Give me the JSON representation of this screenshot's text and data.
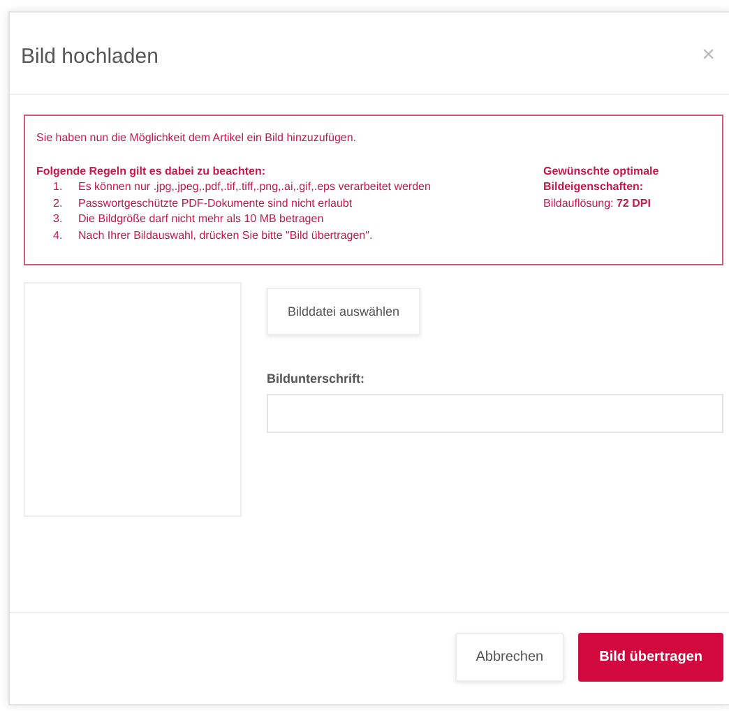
{
  "dialog": {
    "title": "Bild hochladen",
    "close": "×"
  },
  "notice": {
    "intro": "Sie haben nun die Möglichkeit dem Artikel ein Bild hinzuzufügen.",
    "rules_title": "Folgende Regeln gilt es dabei zu beachten:",
    "rules": [
      {
        "number": "1.",
        "text": "Es können nur .jpg,.jpeg,.pdf,.tif,.tiff,.png,.ai,.gif,.eps verarbeitet werden"
      },
      {
        "number": "2.",
        "text": "Passwortgeschützte PDF-Dokumente sind nicht erlaubt"
      },
      {
        "number": "3.",
        "text": "Die Bildgröße darf nicht mehr als 10 MB betragen"
      },
      {
        "number": "4.",
        "text": "Nach Ihrer Bildauswahl, drücken Sie bitte \"Bild übertragen\"."
      }
    ],
    "properties_title": "Gewünschte optimale Bildeigenschaften:",
    "resolution": "Bildauflösung: **72 DPI**"
  },
  "upload": {
    "choose_button": "Bilddatei auswählen",
    "caption_label": "Bildunterschrift:"
  },
  "buttons": [
    {
      "label": "Abbrechen",
      "kind": "secondary"
    },
    {
      "label": "Bild übertragen",
      "kind": "primary"
    }
  ]
}
